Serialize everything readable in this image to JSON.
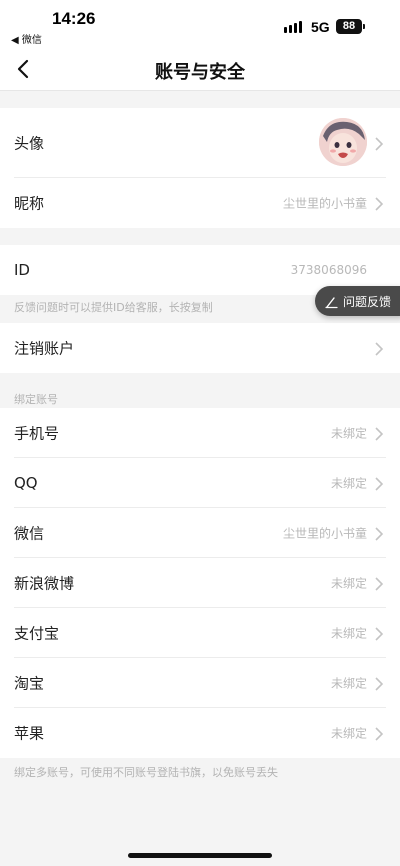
{
  "status_bar": {
    "time": "14:26",
    "back_app": "◀ 微信",
    "network": "5G",
    "battery": "88"
  },
  "nav": {
    "title": "账号与安全",
    "back_icon": "chevron-left-icon"
  },
  "profile": {
    "avatar_label": "头像",
    "nickname_label": "昵称",
    "nickname_value": "尘世里的小书童"
  },
  "id_section": {
    "label": "ID",
    "value": "3738068096",
    "note": "反馈问题时可以提供ID给客服，长按复制"
  },
  "cancel_account": {
    "label": "注销账户"
  },
  "bind_section": {
    "header": "绑定账号",
    "items": [
      {
        "label": "手机号",
        "value": "未绑定"
      },
      {
        "label": "QQ",
        "value": "未绑定"
      },
      {
        "label": "微信",
        "value": "尘世里的小书童"
      },
      {
        "label": "新浪微博",
        "value": "未绑定"
      },
      {
        "label": "支付宝",
        "value": "未绑定"
      },
      {
        "label": "淘宝",
        "value": "未绑定"
      },
      {
        "label": "苹果",
        "value": "未绑定"
      }
    ],
    "footer_note": "绑定多账号，可使用不同账号登陆书旗，以免账号丢失"
  },
  "feedback": {
    "label": "问题反馈",
    "icon": "edit-icon"
  },
  "colors": {
    "background": "#f4f4f4",
    "secondary_text": "#b8b8b8",
    "feedback_bg": "#4a4a4a"
  }
}
